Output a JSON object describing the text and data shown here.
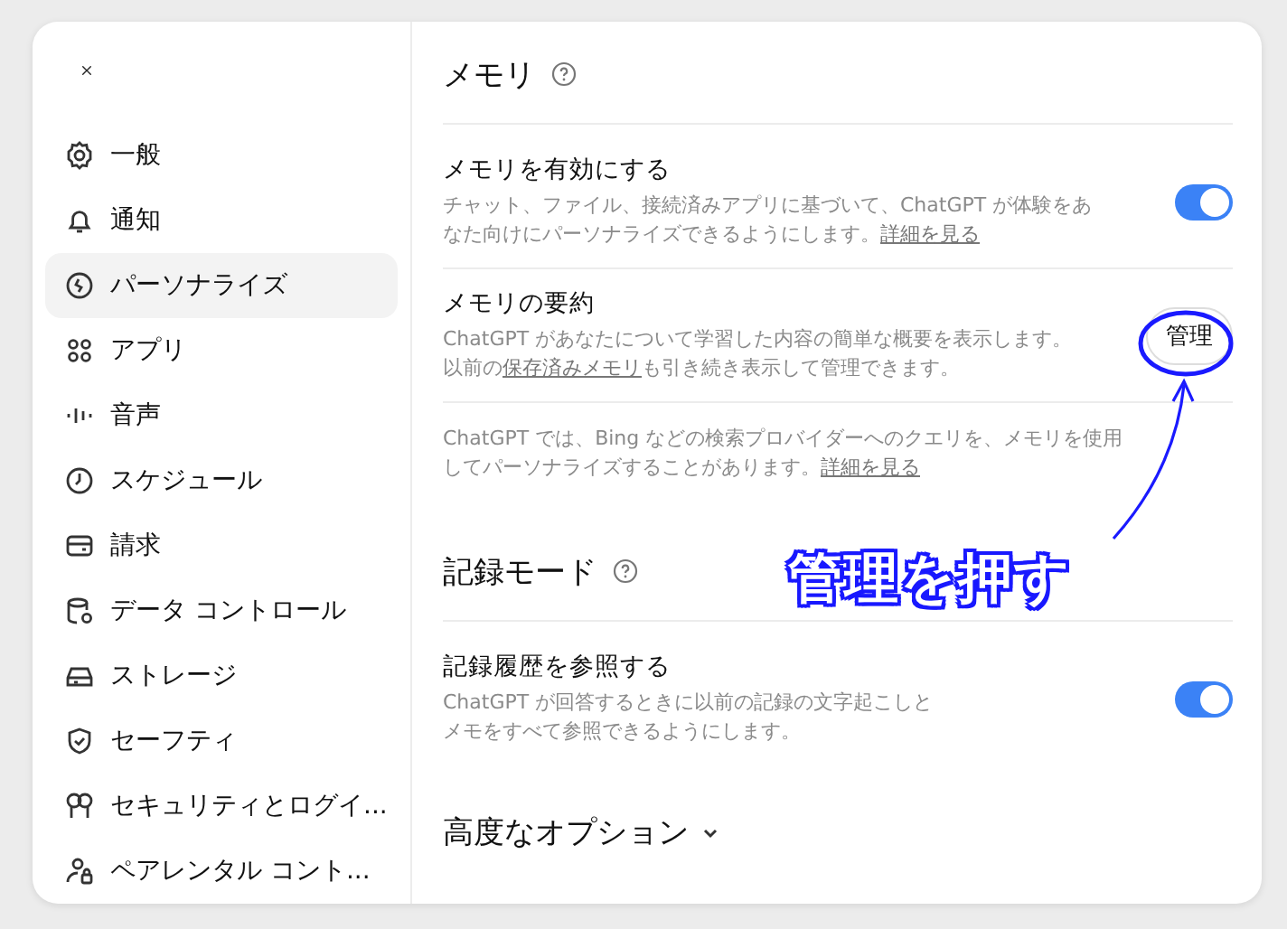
{
  "sidebar": {
    "items": [
      {
        "label": "一般",
        "selected": false
      },
      {
        "label": "通知",
        "selected": false
      },
      {
        "label": "パーソナライズ",
        "selected": true
      },
      {
        "label": "アプリ",
        "selected": false
      },
      {
        "label": "音声",
        "selected": false
      },
      {
        "label": "スケジュール",
        "selected": false
      },
      {
        "label": "請求",
        "selected": false
      },
      {
        "label": "データ コントロール",
        "selected": false
      },
      {
        "label": "ストレージ",
        "selected": false
      },
      {
        "label": "セーフティ",
        "selected": false
      },
      {
        "label": "セキュリティとログイ...",
        "selected": false
      },
      {
        "label": "ペアレンタル コント...",
        "selected": false
      }
    ]
  },
  "sections": [
    {
      "title": "メモリ",
      "rows": [
        {
          "kind": "toggle",
          "title": "メモリを有効にする",
          "on": true,
          "description": [
            {
              "text": "チャット、ファイル、接続済みアプリに基づいて、ChatGPT が体験をあなた向けにパーソナライズできるようにします。",
              "link": false
            },
            {
              "text": "詳細を見る",
              "link": true
            }
          ]
        },
        {
          "kind": "button",
          "title": "メモリの要約",
          "button": "管理",
          "description": [
            {
              "text": "ChatGPT があなたについて学習した内容の簡単な概要を表示します。以前の",
              "link": false
            },
            {
              "text": "保存済みメモリ",
              "link": true
            },
            {
              "text": "も引き続き表示して管理できます。",
              "link": false
            }
          ]
        },
        {
          "kind": "note",
          "description": [
            {
              "text": "ChatGPT では、Bing などの検索プロバイダーへのクエリを、メモリを使用してパーソナライズすることがあります。",
              "link": false
            },
            {
              "text": "詳細を見る",
              "link": true
            }
          ]
        }
      ]
    },
    {
      "title": "記録モード",
      "rows": [
        {
          "kind": "toggle",
          "title": "記録履歴を参照する",
          "on": true,
          "description": [
            {
              "text": "ChatGPT が回答するときに以前の記録の文字起こしとメモをすべて参照できるようにします。",
              "link": false
            }
          ]
        }
      ]
    }
  ],
  "advanced": {
    "label": "高度なオプション",
    "expanded": false
  },
  "annotation": {
    "text": "管理を押す"
  }
}
